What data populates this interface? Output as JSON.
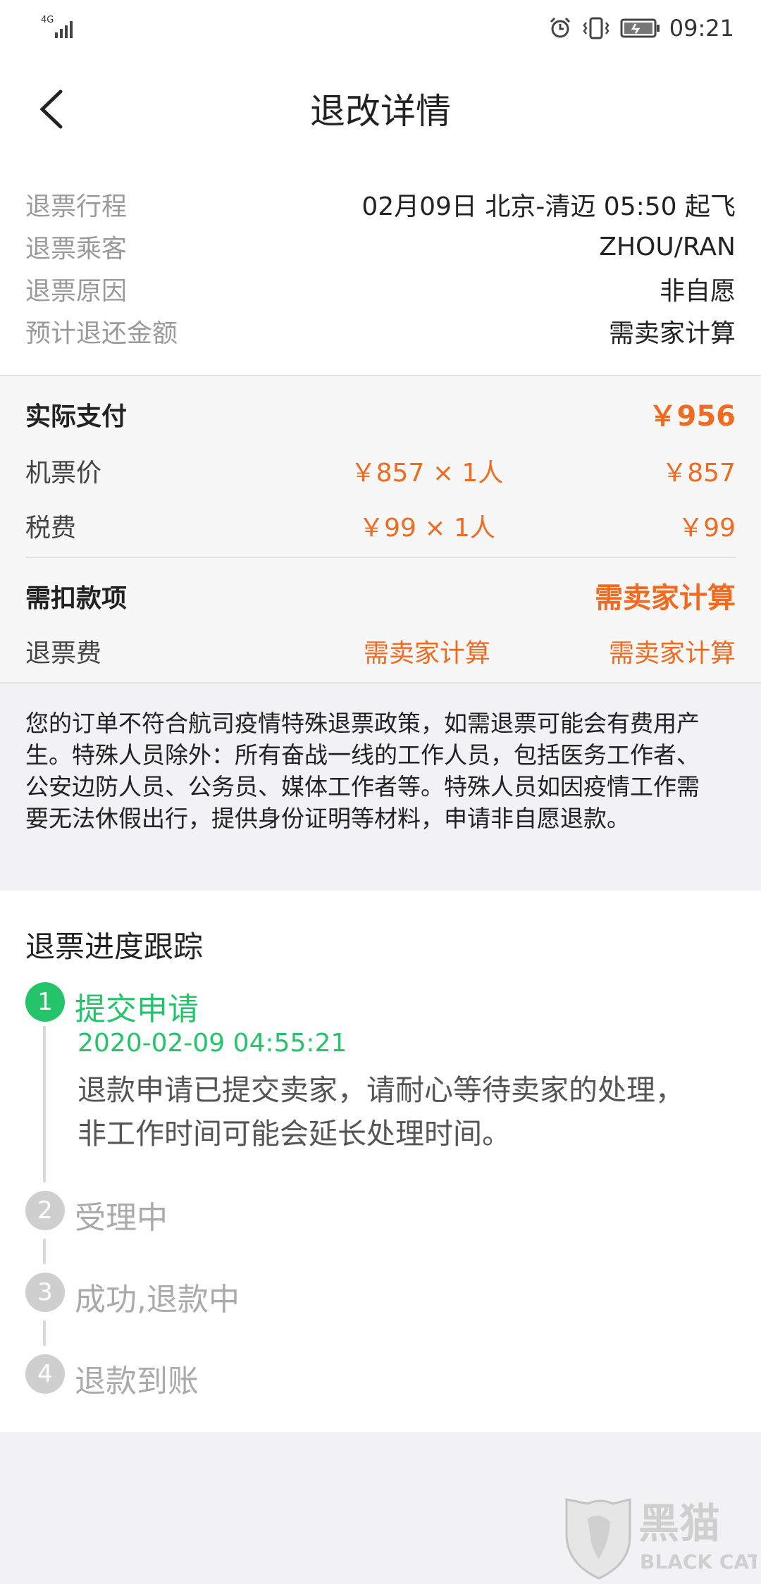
{
  "status_bar": {
    "network": "4G",
    "time": "09:21"
  },
  "header": {
    "title": "退改详情"
  },
  "refund_info": {
    "rows": [
      {
        "label": "退票行程",
        "value": "02月09日 北京-清迈 05:50 起飞",
        "highlight": false
      },
      {
        "label": "退票乘客",
        "value": "ZHOU/RAN",
        "highlight": false
      },
      {
        "label": "退票原因",
        "value": "非自愿",
        "highlight": false
      },
      {
        "label": "预计退还金额",
        "value": "需卖家计算",
        "highlight": true
      }
    ]
  },
  "payment": {
    "actual_label": "实际支付",
    "actual_value": "￥956",
    "items": [
      {
        "label": "机票价",
        "unit": "￥857 × 1人",
        "total": "￥857"
      },
      {
        "label": "税费",
        "unit": "￥99 × 1人",
        "total": "￥99"
      }
    ],
    "deduct_label": "需扣款项",
    "deduct_value": "需卖家计算",
    "fee": {
      "label": "退票费",
      "unit": "需卖家计算",
      "total": "需卖家计算"
    }
  },
  "notice": {
    "text": "您的订单不符合航司疫情特殊退票政策，如需退票可能会有费用产生。特殊人员除外：所有奋战一线的工作人员，包括医务工作者、公安边防人员、公务员、媒体工作者等。特殊人员如因疫情工作需要无法休假出行，提供身份证明等材料，申请非自愿退款。"
  },
  "progress": {
    "title": "退票进度跟踪",
    "steps": [
      {
        "num": "1",
        "name": "提交申请",
        "time": "2020-02-09 04:55:21",
        "desc": "退款申请已提交卖家，请耐心等待卖家的处理，非工作时间可能会延长处理时间。",
        "active": true
      },
      {
        "num": "2",
        "name": "受理中",
        "active": false
      },
      {
        "num": "3",
        "name": "成功,退款中",
        "active": false
      },
      {
        "num": "4",
        "name": "退款到账",
        "active": false
      }
    ]
  },
  "watermark": {
    "brand_cn": "黑猫",
    "brand_en": "BLACK CAT"
  },
  "colors": {
    "accent_orange": "#f06a1f",
    "active_green": "#25c46a",
    "inactive_gray": "#cfcfcf"
  }
}
